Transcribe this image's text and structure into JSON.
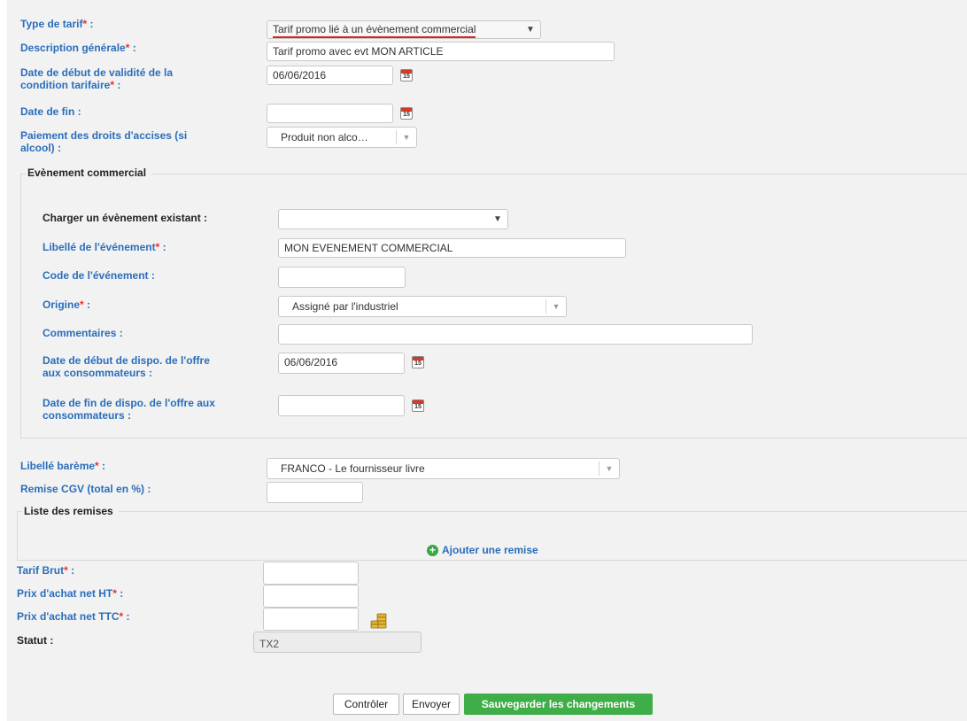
{
  "form": {
    "required_mark": "*",
    "type_tarif_label": "Type de tarif",
    "type_tarif_value": "Tarif promo lié à un évènement commercial",
    "description_label": "Description générale",
    "description_value": "Tarif promo avec evt MON ARTICLE",
    "date_debut_label_1": "Date de début de validité de la",
    "date_debut_label_2": "condition tarifaire",
    "date_debut_value": "06/06/2016",
    "date_fin_label": "Date de fin :",
    "date_fin_value": "",
    "accises_label_1": "Paiement des droits d'accises (si",
    "accises_label_2": "alcool) :",
    "accises_value": "Produit non alco…",
    "calendar_day": "15",
    "colon": " :"
  },
  "evenement": {
    "section_title": "Evènement commercial",
    "charger_label": "Charger un évènement existant :",
    "charger_value": "",
    "libelle_label": "Libellé de l'événement",
    "libelle_value": "MON EVENEMENT COMMERCIAL",
    "code_label": "Code de l'événement :",
    "code_value": "",
    "origine_label": "Origine",
    "origine_value": "Assigné par l'industriel",
    "commentaires_label": "Commentaires :",
    "commentaires_value": "",
    "dispo_debut_label_1": "Date de début de dispo. de l'offre",
    "dispo_debut_label_2": "aux consommateurs :",
    "dispo_debut_value": "06/06/2016",
    "dispo_fin_label_1": "Date de fin de dispo. de l'offre aux",
    "dispo_fin_label_2": "consommateurs :",
    "dispo_fin_value": ""
  },
  "bareme": {
    "libelle_label": "Libellé barème",
    "libelle_value": "FRANCO - Le fournisseur livre",
    "remise_cgv_label": "Remise CGV (total en %) :",
    "remise_cgv_value": ""
  },
  "remises": {
    "section_title": "Liste des remises",
    "add_label": "Ajouter une remise"
  },
  "prix": {
    "tarif_brut_label": "Tarif Brut",
    "tarif_brut_value": "",
    "net_ht_label": "Prix d'achat net HT",
    "net_ht_value": "",
    "net_ttc_label": "Prix d'achat net TTC",
    "net_ttc_value": "",
    "statut_label": "Statut :",
    "statut_value": "TX2"
  },
  "actions": {
    "controler": "Contrôler",
    "envoyer": "Envoyer",
    "sauvegarder": "Sauvegarder les changements"
  },
  "colors": {
    "label_blue": "#2a6ebb",
    "required_red": "#e8312b",
    "save_green": "#3fae49",
    "panel_gray": "#f2f2f2"
  },
  "icons": {
    "calendar": "calendar-icon",
    "dropdown": "chevron-down-icon",
    "add": "plus-circle-icon",
    "coins": "coins-icon"
  }
}
